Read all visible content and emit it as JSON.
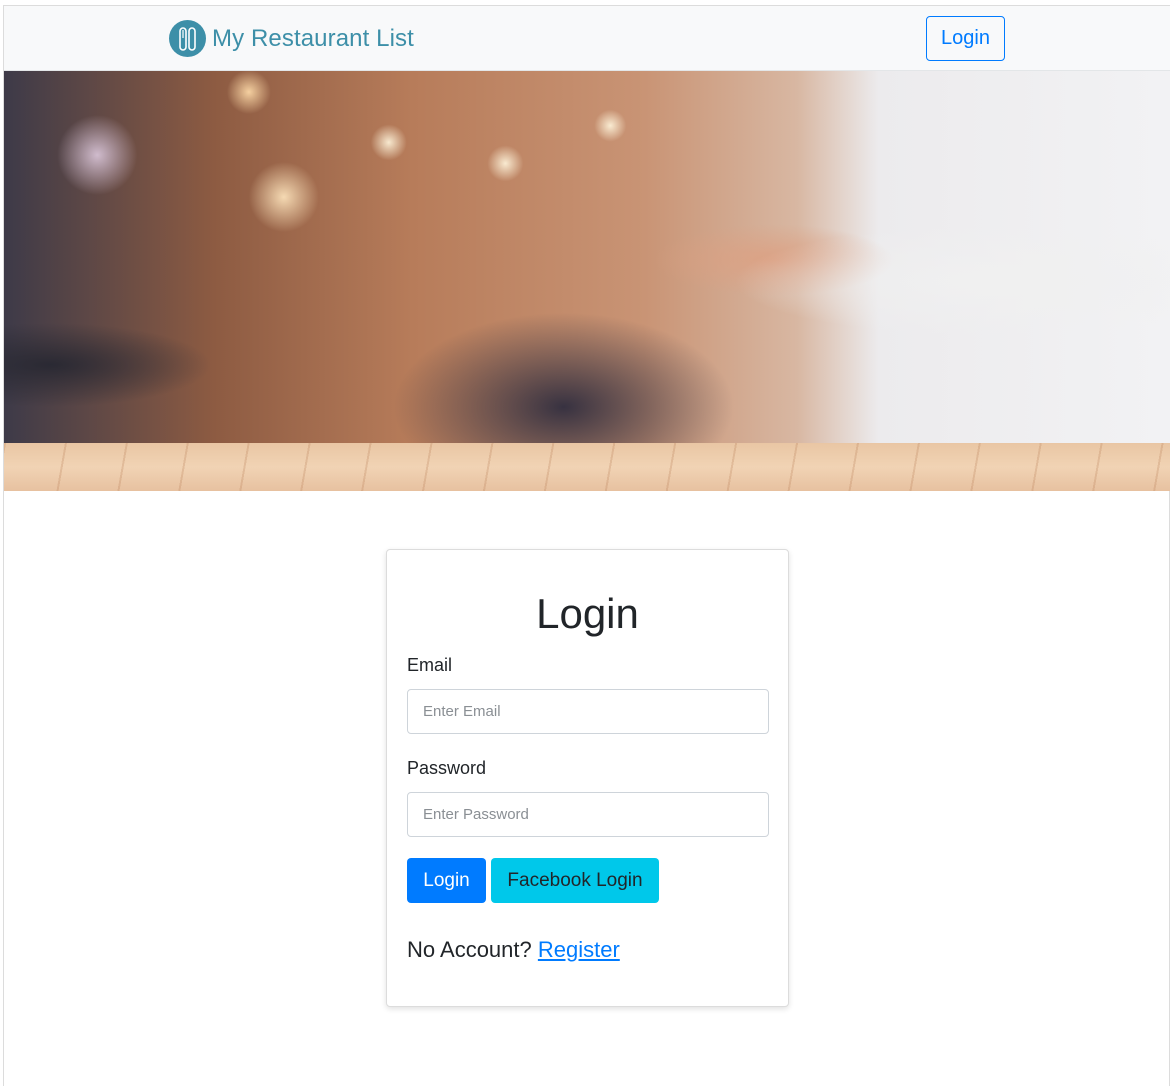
{
  "navbar": {
    "brand_text": "My Restaurant List",
    "brand_icon": "utensils-icon",
    "login_button": "Login"
  },
  "hero": {
    "image": "blurred-restaurant-interior"
  },
  "login_form": {
    "title": "Login",
    "email_label": "Email",
    "email_placeholder": "Enter Email",
    "email_value": "",
    "password_label": "Password",
    "password_placeholder": "Enter Password",
    "password_value": "",
    "login_button": "Login",
    "facebook_button": "Facebook Login",
    "no_account_text": "No Account? ",
    "register_link": "Register"
  },
  "colors": {
    "brand": "#3d8fa8",
    "primary": "#007bff",
    "info": "#00c8ea"
  }
}
